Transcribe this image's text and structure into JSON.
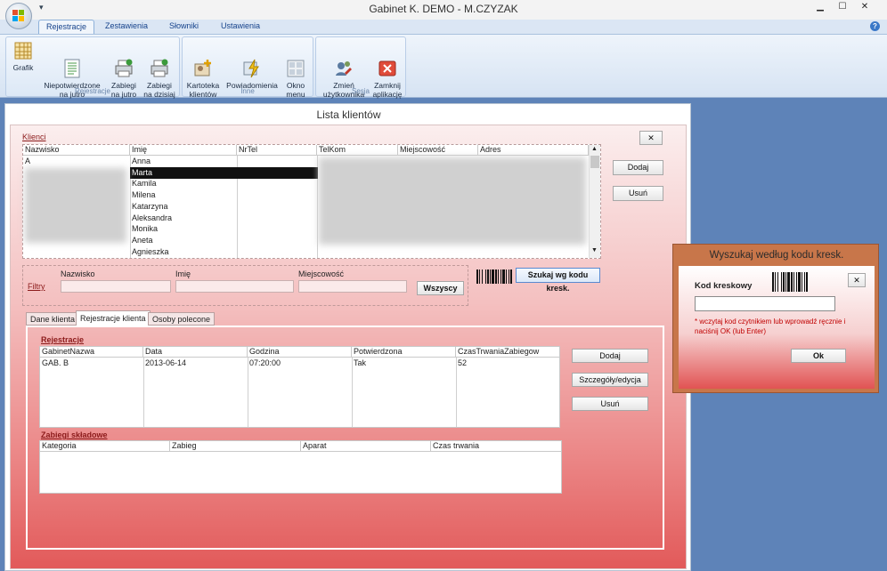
{
  "app": {
    "title": "Gabinet K. DEMO - M.CZYZAK"
  },
  "ribbon": {
    "tabs": [
      "Rejestracje",
      "Zestawienia",
      "Słowniki",
      "Ustawienia"
    ],
    "groups": [
      {
        "label": "Rejestracje",
        "buttons": [
          {
            "label": "Grafik"
          },
          {
            "label": "Niepotwierdzone\nna jutro"
          },
          {
            "label": "Zabiegi\nna jutro"
          },
          {
            "label": "Zabiegi\nna dzisiaj"
          }
        ]
      },
      {
        "label": "Inne",
        "buttons": [
          {
            "label": "Kartoteka\nklientów"
          },
          {
            "label": "Powiadomienia"
          },
          {
            "label": "Okno\nmenu"
          }
        ]
      },
      {
        "label": "Sesja",
        "buttons": [
          {
            "label": "Zmień\nużytkownika"
          },
          {
            "label": "Zamknij\naplikację"
          }
        ]
      }
    ]
  },
  "main": {
    "title": "Lista klientów",
    "close_label": "✕",
    "clients_label": "Klienci",
    "columns": [
      "Nazwisko",
      "Imię",
      "NrTel",
      "TelKom",
      "Miejscowość",
      "Adres"
    ],
    "rows": [
      [
        "A",
        "Anna",
        "",
        "",
        "",
        ""
      ],
      [
        "",
        "Marta",
        "",
        "",
        "",
        ""
      ],
      [
        "",
        "Kamila",
        "",
        "",
        "",
        ""
      ],
      [
        "",
        "Milena",
        "",
        "",
        "",
        ""
      ],
      [
        "",
        "Katarzyna",
        "",
        "",
        "",
        ""
      ],
      [
        "",
        "Aleksandra",
        "",
        "",
        "",
        ""
      ],
      [
        "",
        "Monika",
        "",
        "",
        "",
        ""
      ],
      [
        "",
        "Aneta",
        "",
        "",
        "",
        ""
      ],
      [
        "",
        "Agnieszka",
        "",
        "",
        "",
        ""
      ]
    ],
    "add_label": "Dodaj",
    "remove_label": "Usuń",
    "filters": {
      "label": "Filtry",
      "surname_label": "Nazwisko",
      "name_label": "Imię",
      "city_label": "Miejscowość",
      "all_label": "Wszyscy",
      "barcode_search_label": "Szukaj wg kodu kresk."
    },
    "tabs": [
      "Dane klienta",
      "Rejestracje klienta",
      "Osoby polecone"
    ],
    "registrations": {
      "label": "Rejestracje",
      "columns": [
        "GabinetNazwa",
        "Data",
        "Godzina",
        "Potwierdzona",
        "CzasTrwaniaZabiegow"
      ],
      "rows": [
        [
          "GAB. B",
          "2013-06-14",
          "07:20:00",
          "Tak",
          "52"
        ]
      ],
      "add_label": "Dodaj",
      "edit_label": "Szczegóły/edycja",
      "remove_label": "Usuń"
    },
    "treatments": {
      "label": "Zabiegi składowe",
      "columns": [
        "Kategoria",
        "Zabieg",
        "Aparat",
        "Czas trwania"
      ]
    }
  },
  "barcode_dialog": {
    "title": "Wyszukaj według kodu kresk.",
    "field_label": "Kod kreskowy",
    "close_label": "✕",
    "hint": "* wczytaj kod czytnikiem lub wprowadź ręcznie i naciśnij OK (lub Enter)",
    "ok_label": "Ok"
  },
  "colors": {
    "accent": "#e25a5a",
    "ribbon": "#dce8f6",
    "desktop": "#5e83b8"
  }
}
